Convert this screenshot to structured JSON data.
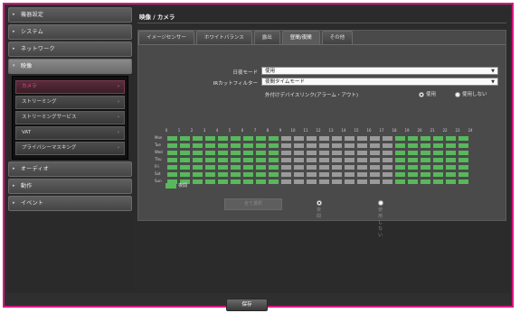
{
  "sidebar": {
    "items": [
      {
        "label": "機器設定"
      },
      {
        "label": "システム"
      },
      {
        "label": "ネットワーク"
      },
      {
        "label": "映像"
      },
      {
        "label": "オーディオ"
      },
      {
        "label": "動作"
      },
      {
        "label": "イベント"
      }
    ],
    "video_submenu": [
      {
        "label": "カメラ"
      },
      {
        "label": "ストリーミング"
      },
      {
        "label": "ストリーミングサービス"
      },
      {
        "label": "VAT"
      },
      {
        "label": "プライバシーマスキング"
      }
    ]
  },
  "page": {
    "title": "映像 / カメラ"
  },
  "tabs": [
    {
      "label": "イメージセンサー"
    },
    {
      "label": "ホワイトバランス"
    },
    {
      "label": "露出"
    },
    {
      "label": "昼間/夜間"
    },
    {
      "label": "その他"
    }
  ],
  "form": {
    "day_night_mode_label": "日夜モード",
    "day_night_mode_value": "使用",
    "ir_cut_filter_label": "IRカットフィルター",
    "ir_cut_filter_value": "夜間タイムモード",
    "external_device_label": "外付けデバイスリンク(アラーム・アウト)",
    "use_label": "使用",
    "not_use_label": "使用しない"
  },
  "schedule": {
    "hours": [
      "0",
      "1",
      "2",
      "3",
      "4",
      "5",
      "6",
      "7",
      "8",
      "9",
      "10",
      "11",
      "12",
      "13",
      "14",
      "15",
      "16",
      "17",
      "18",
      "19",
      "20",
      "21",
      "22",
      "23",
      "24"
    ],
    "days": [
      "Mon",
      "Tue",
      "Wed",
      "Thu",
      "Fri",
      "Sat",
      "Sun"
    ],
    "on_hours_start": [
      0,
      1,
      2,
      3,
      4,
      5,
      6,
      7,
      8,
      18,
      19,
      20,
      21,
      22,
      23
    ],
    "legend_label": "夜間",
    "legend_color": "#58b85c",
    "select_all_label": "全て選択",
    "night_label": "夜間",
    "clear_label": "使用しない"
  },
  "footer": {
    "save_label": "保存"
  },
  "colors": {
    "accent": "#d6187f",
    "active_sub": "#e0559a",
    "schedule_on": "#58b85c",
    "schedule_off": "#9a9a9a"
  }
}
